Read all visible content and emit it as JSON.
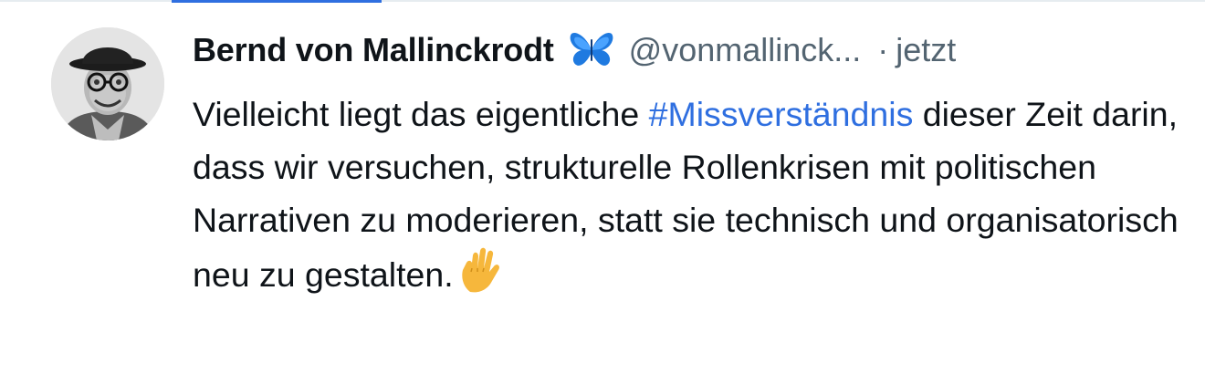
{
  "post": {
    "author": {
      "name": "Bernd von Mallinckrodt",
      "handle": "@vonmallinck...",
      "verified_icon": "butterfly-icon",
      "avatar": "avatar"
    },
    "timestamp_separator": "·",
    "timestamp": "jetzt",
    "text": {
      "part1": "Vielleicht liegt das eigentliche ",
      "hashtag": "#Missverständnis",
      "part2": " dieser Zeit darin, dass wir versuchen, strukturelle Rollenkrisen mit politischen Narrativen zu moderieren, statt sie technisch und organisatorisch neu zu gestalten.",
      "emoji": "vulcan-salute-icon"
    }
  },
  "colors": {
    "link": "#2f6fe0",
    "text": "#0f1419",
    "muted": "#536471",
    "tab_indicator": "#2f6fe0"
  }
}
